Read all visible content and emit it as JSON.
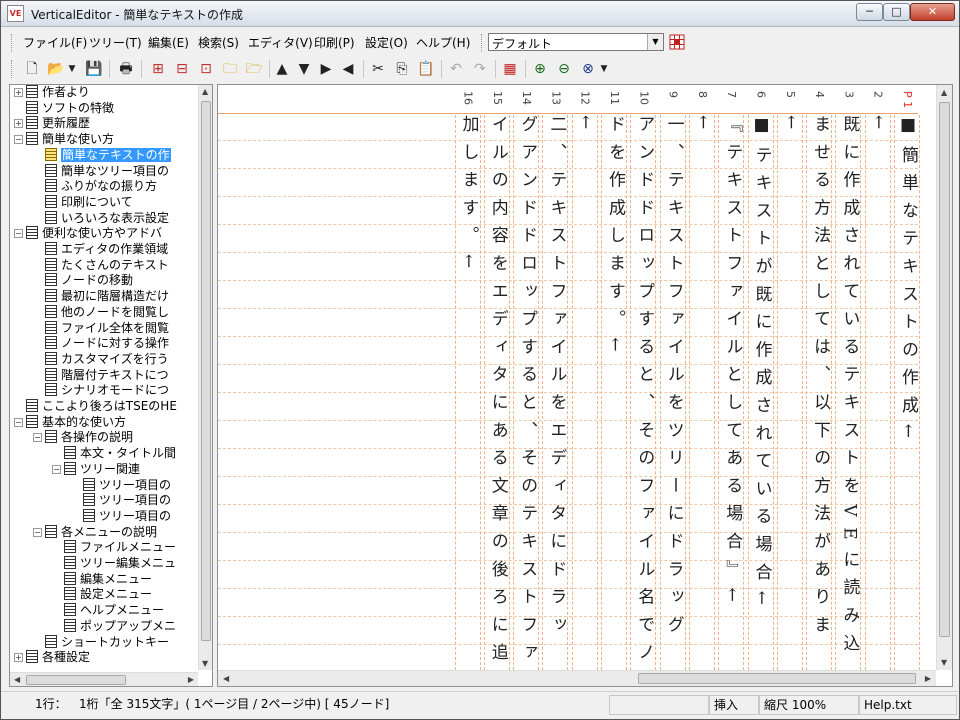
{
  "window": {
    "title": "VerticalEditor - 簡単なテキストの作成",
    "app_icon_text": "VE",
    "minimize": "─",
    "maximize": "□",
    "close": "✕"
  },
  "menu": [
    "ファイル(F)",
    "ツリー(T)",
    "編集(E)",
    "検索(S)",
    "エディタ(V)",
    "印刷(P)",
    "設定(O)",
    "ヘルプ(H)"
  ],
  "style_combo": {
    "value": "デフォルト"
  },
  "tree": [
    {
      "label": "作者より",
      "level": 0,
      "pm": "+"
    },
    {
      "label": "ソフトの特徴",
      "level": 0,
      "pm": ""
    },
    {
      "label": "更新履歴",
      "level": 0,
      "pm": "+"
    },
    {
      "label": "簡単な使い方",
      "level": 0,
      "pm": "-"
    },
    {
      "label": "簡単なテキストの作",
      "level": 1,
      "pm": "",
      "selected": true
    },
    {
      "label": "簡単なツリー項目の",
      "level": 1,
      "pm": ""
    },
    {
      "label": "ふりがなの振り方",
      "level": 1,
      "pm": ""
    },
    {
      "label": "印刷について",
      "level": 1,
      "pm": ""
    },
    {
      "label": "いろいろな表示設定",
      "level": 1,
      "pm": ""
    },
    {
      "label": "便利な使い方やアドバ",
      "level": 0,
      "pm": "-"
    },
    {
      "label": "エディタの作業領域",
      "level": 1,
      "pm": ""
    },
    {
      "label": "たくさんのテキスト",
      "level": 1,
      "pm": ""
    },
    {
      "label": "ノードの移動",
      "level": 1,
      "pm": ""
    },
    {
      "label": "最初に階層構造だけ",
      "level": 1,
      "pm": ""
    },
    {
      "label": "他のノードを閲覧し",
      "level": 1,
      "pm": ""
    },
    {
      "label": "ファイル全体を閲覧",
      "level": 1,
      "pm": ""
    },
    {
      "label": "ノードに対する操作",
      "level": 1,
      "pm": ""
    },
    {
      "label": "カスタマイズを行う",
      "level": 1,
      "pm": ""
    },
    {
      "label": "階層付テキストにつ",
      "level": 1,
      "pm": ""
    },
    {
      "label": "シナリオモードにつ",
      "level": 1,
      "pm": ""
    },
    {
      "label": "ここより後ろはTSEのHE",
      "level": 0,
      "pm": ""
    },
    {
      "label": "基本的な使い方",
      "level": 0,
      "pm": "-"
    },
    {
      "label": "各操作の説明",
      "level": 1,
      "pm": "-"
    },
    {
      "label": "本文・タイトル間",
      "level": 2,
      "pm": ""
    },
    {
      "label": "ツリー関連",
      "level": 2,
      "pm": "-"
    },
    {
      "label": "ツリー項目の",
      "level": 3,
      "pm": ""
    },
    {
      "label": "ツリー項目の",
      "level": 3,
      "pm": ""
    },
    {
      "label": "ツリー項目の",
      "level": 3,
      "pm": ""
    },
    {
      "label": "各メニューの説明",
      "level": 1,
      "pm": "-"
    },
    {
      "label": "ファイルメニュー",
      "level": 2,
      "pm": ""
    },
    {
      "label": "ツリー編集メニュ",
      "level": 2,
      "pm": ""
    },
    {
      "label": "編集メニュー",
      "level": 2,
      "pm": ""
    },
    {
      "label": "設定メニュー",
      "level": 2,
      "pm": ""
    },
    {
      "label": "ヘルプメニュー",
      "level": 2,
      "pm": ""
    },
    {
      "label": "ポップアップメニ",
      "level": 2,
      "pm": ""
    },
    {
      "label": "ショートカットキー",
      "level": 1,
      "pm": ""
    },
    {
      "label": "各種設定",
      "level": 0,
      "pm": "+"
    }
  ],
  "editor": {
    "columns": [
      {
        "num": "P 1",
        "text": "■簡単なテキストの作成←",
        "page": true
      },
      {
        "num": "2",
        "text": "←"
      },
      {
        "num": "3",
        "text": "既に作成されているテキストをVEに読み込"
      },
      {
        "num": "4",
        "text": "ませる方法としては、以下の方法がありま"
      },
      {
        "num": "5",
        "text": "←"
      },
      {
        "num": "6",
        "text": "■テキストが既に作成されている場合←"
      },
      {
        "num": "7",
        "text": "『テキストファイルとしてある場合』←"
      },
      {
        "num": "8",
        "text": "←"
      },
      {
        "num": "9",
        "text": "一、テキストファイルをツリーにドラッグ"
      },
      {
        "num": "10",
        "text": "アンドドロップすると、そのファイル名でノ"
      },
      {
        "num": "11",
        "text": "ドを作成します。←"
      },
      {
        "num": "12",
        "text": "←"
      },
      {
        "num": "13",
        "text": "二、テキストファイルをエディタにドラッ"
      },
      {
        "num": "14",
        "text": "グアンドドロップすると、そのテキストファ"
      },
      {
        "num": "15",
        "text": "イルの内容をエディタにある文章の後ろに追"
      },
      {
        "num": "16",
        "text": "加します。←"
      }
    ]
  },
  "status": {
    "line": "1行：",
    "col": "1桁「全 315文字」( 1ページ目 / 2ページ中) [ 45ノード]",
    "mode": "挿入",
    "zoom": "縮尺 100%",
    "file": "Help.txt"
  }
}
